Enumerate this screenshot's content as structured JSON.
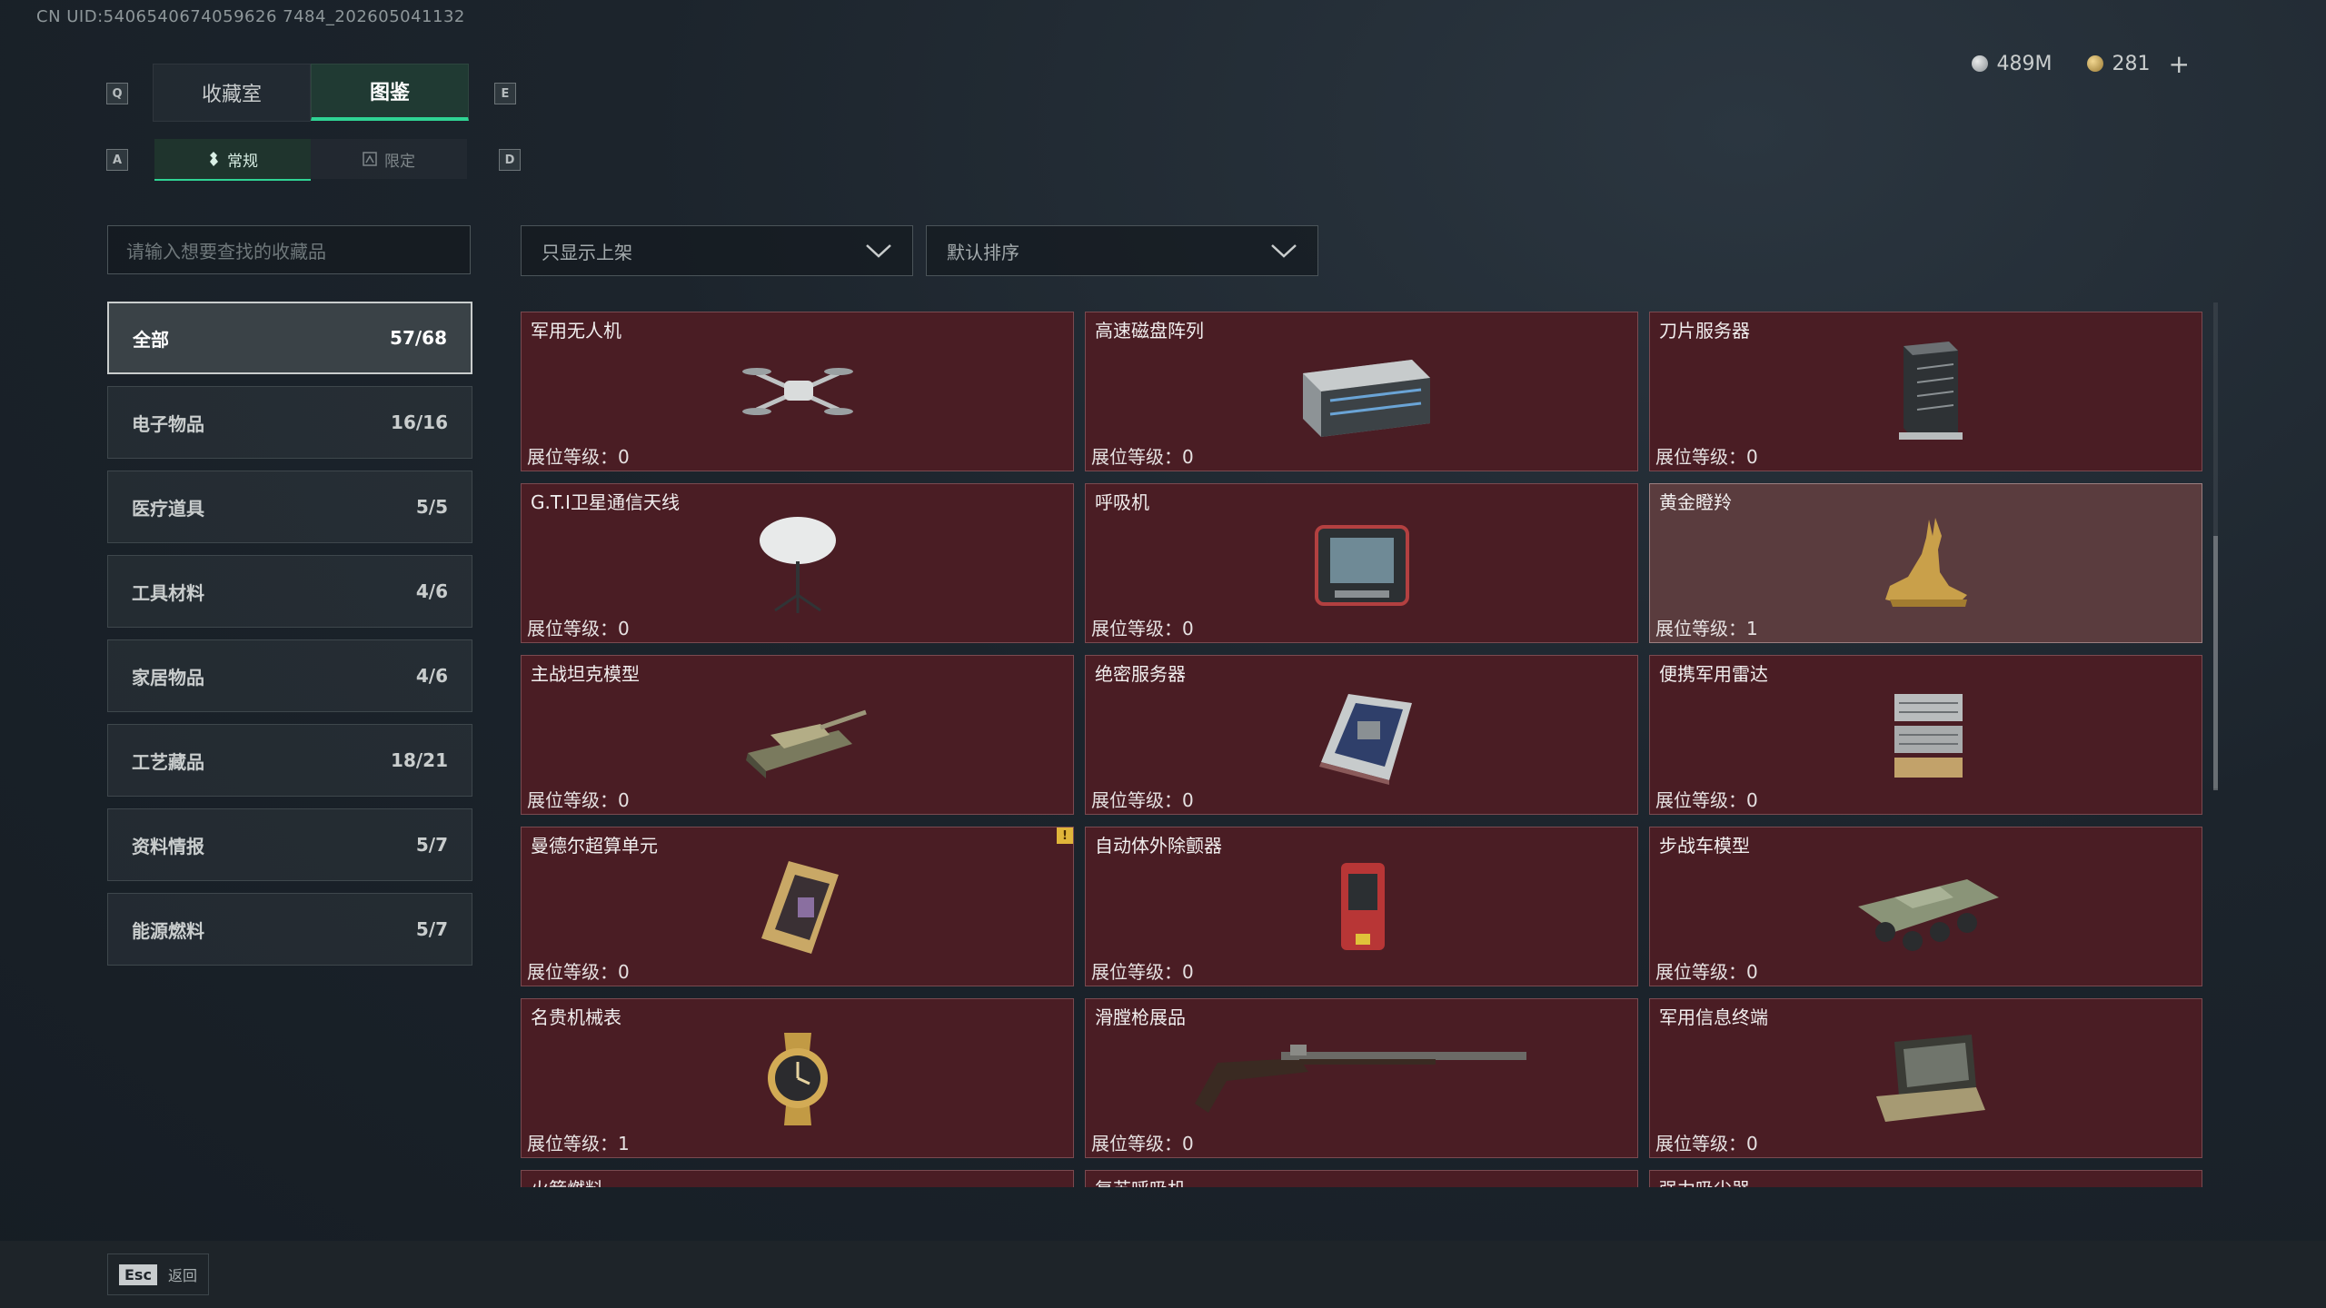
{
  "uid_text": "CN UID:5406540674059626 7484_202605041132",
  "currency": {
    "silver": "489M",
    "gold": "281",
    "add": "+"
  },
  "keys": {
    "q": "Q",
    "e": "E",
    "a": "A",
    "d": "D",
    "esc": "Esc"
  },
  "tabs": [
    {
      "label": "收藏室"
    },
    {
      "label": "图鉴"
    }
  ],
  "subtabs": [
    {
      "label": "常规"
    },
    {
      "label": "限定"
    }
  ],
  "search": {
    "placeholder": "请输入想要查找的收藏品"
  },
  "filters": {
    "display": "只显示上架",
    "sort": "默认排序"
  },
  "categories": [
    {
      "label": "全部",
      "count": "57/68"
    },
    {
      "label": "电子物品",
      "count": "16/16"
    },
    {
      "label": "医疗道具",
      "count": "5/5"
    },
    {
      "label": "工具材料",
      "count": "4/6"
    },
    {
      "label": "家居物品",
      "count": "4/6"
    },
    {
      "label": "工艺藏品",
      "count": "18/21"
    },
    {
      "label": "资料情报",
      "count": "5/7"
    },
    {
      "label": "能源燃料",
      "count": "5/7"
    }
  ],
  "level_label": "展位等级：",
  "items": [
    {
      "name": "军用无人机",
      "level": "0",
      "icon": "drone-icon"
    },
    {
      "name": "高速磁盘阵列",
      "level": "0",
      "icon": "disk-array-icon"
    },
    {
      "name": "刀片服务器",
      "level": "0",
      "icon": "blade-server-icon"
    },
    {
      "name": "G.T.I卫星通信天线",
      "level": "0",
      "icon": "satellite-dish-icon"
    },
    {
      "name": "呼吸机",
      "level": "0",
      "icon": "ventilator-icon"
    },
    {
      "name": "黄金瞪羚",
      "level": "1",
      "icon": "golden-gazelle-icon"
    },
    {
      "name": "主战坦克模型",
      "level": "0",
      "icon": "tank-model-icon"
    },
    {
      "name": "绝密服务器",
      "level": "0",
      "icon": "secret-server-icon"
    },
    {
      "name": "便携军用雷达",
      "level": "0",
      "icon": "portable-radar-icon"
    },
    {
      "name": "曼德尔超算单元",
      "level": "0",
      "icon": "supercomputer-unit-icon",
      "flag": "!"
    },
    {
      "name": "自动体外除颤器",
      "level": "0",
      "icon": "defibrillator-icon"
    },
    {
      "name": "步战车模型",
      "level": "0",
      "icon": "ifv-model-icon"
    },
    {
      "name": "名贵机械表",
      "level": "1",
      "icon": "mechanical-watch-icon"
    },
    {
      "name": "滑膛枪展品",
      "level": "0",
      "icon": "musket-icon"
    },
    {
      "name": "军用信息终端",
      "level": "0",
      "icon": "military-terminal-icon"
    },
    {
      "name": "火箭燃料",
      "level": "",
      "icon": ""
    },
    {
      "name": "复苏呼吸机",
      "level": "",
      "icon": ""
    },
    {
      "name": "强力吸尘器",
      "level": "",
      "icon": ""
    }
  ],
  "back_label": "返回"
}
